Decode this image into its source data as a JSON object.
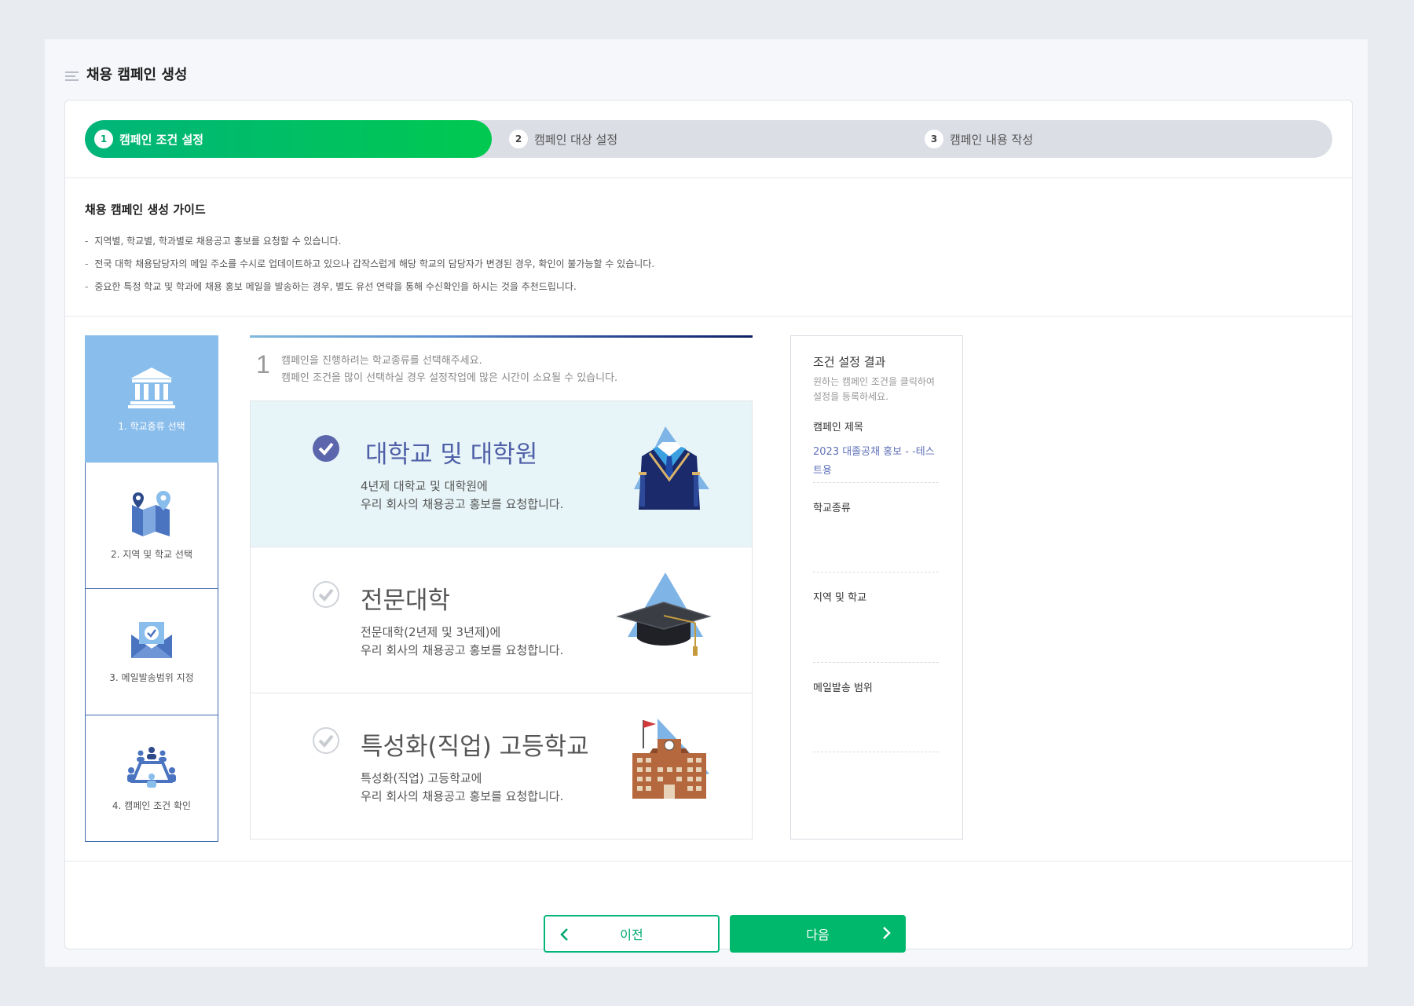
{
  "page": {
    "title": "채용 캠페인 생성"
  },
  "steps": [
    {
      "num": "1",
      "label": "캠페인 조건 설정"
    },
    {
      "num": "2",
      "label": "캠페인 대상 설정"
    },
    {
      "num": "3",
      "label": "캠페인 내용 작성"
    }
  ],
  "guide": {
    "title": "채용 캠페인 생성 가이드",
    "items": [
      "지역별, 학교별, 학과별로 채용공고 홍보를 요청할 수 있습니다.",
      "전국 대학 채용담당자의 메일 주소를 수시로 업데이트하고 있으나 갑작스럽게 해당 학교의 담당자가 변경된 경우, 확인이 불가능할 수 있습니다.",
      "중요한 특정 학교 및 학과에 채용 홍보 메일을 발송하는 경우, 별도 유선 연락을 통해 수신확인을 하시는 것을 추천드립니다."
    ]
  },
  "sidetabs": [
    {
      "label": "1. 학교종류 선택",
      "icon": "school-building-icon"
    },
    {
      "label": "2. 지역 및 학교 선택",
      "icon": "map-pin-icon"
    },
    {
      "label": "3. 메일발송범위 지정",
      "icon": "mail-check-icon"
    },
    {
      "label": "4. 캠페인 조건 확인",
      "icon": "meeting-people-icon"
    }
  ],
  "instruction": {
    "num": "1",
    "line1": "캠페인을 진행하려는 학교종류를 선택해주세요.",
    "line2": "캠페인 조건을 많이 선택하실 경우 설정작업에 많은 시간이 소요될 수 있습니다."
  },
  "options": [
    {
      "name": "대학교 및 대학원",
      "sub1": "4년제 대학교 및 대학원에",
      "sub2": "우리 회사의 채용공고 홍보를 요청합니다.",
      "selected": true
    },
    {
      "name": "전문대학",
      "sub1": "전문대학(2년제 및 3년제)에",
      "sub2": "우리 회사의 채용공고 홍보를 요청합니다.",
      "selected": false
    },
    {
      "name": "특성화(직업) 고등학교",
      "sub1": "특성화(직업) 고등학교에",
      "sub2": "우리 회사의 채용공고 홍보를 요청합니다.",
      "selected": false
    }
  ],
  "result": {
    "title": "조건 설정 결과",
    "note": "원하는 캠페인 조건을 클릭하여 설정을 등록하세요.",
    "campaign_title_label": "캠페인 제목",
    "campaign_title_value": "2023 대졸공채 홍보 - -테스트용",
    "school_type_label": "학교종류",
    "region_label": "지역 및 학교",
    "mail_scope_label": "메일발송 범위"
  },
  "buttons": {
    "prev": "이전",
    "next": "다음"
  },
  "colors": {
    "accent": "#00b86b",
    "tab_active": "#89bdec",
    "option_selected": "#e8f5f8",
    "selected_name": "#5060a8"
  }
}
